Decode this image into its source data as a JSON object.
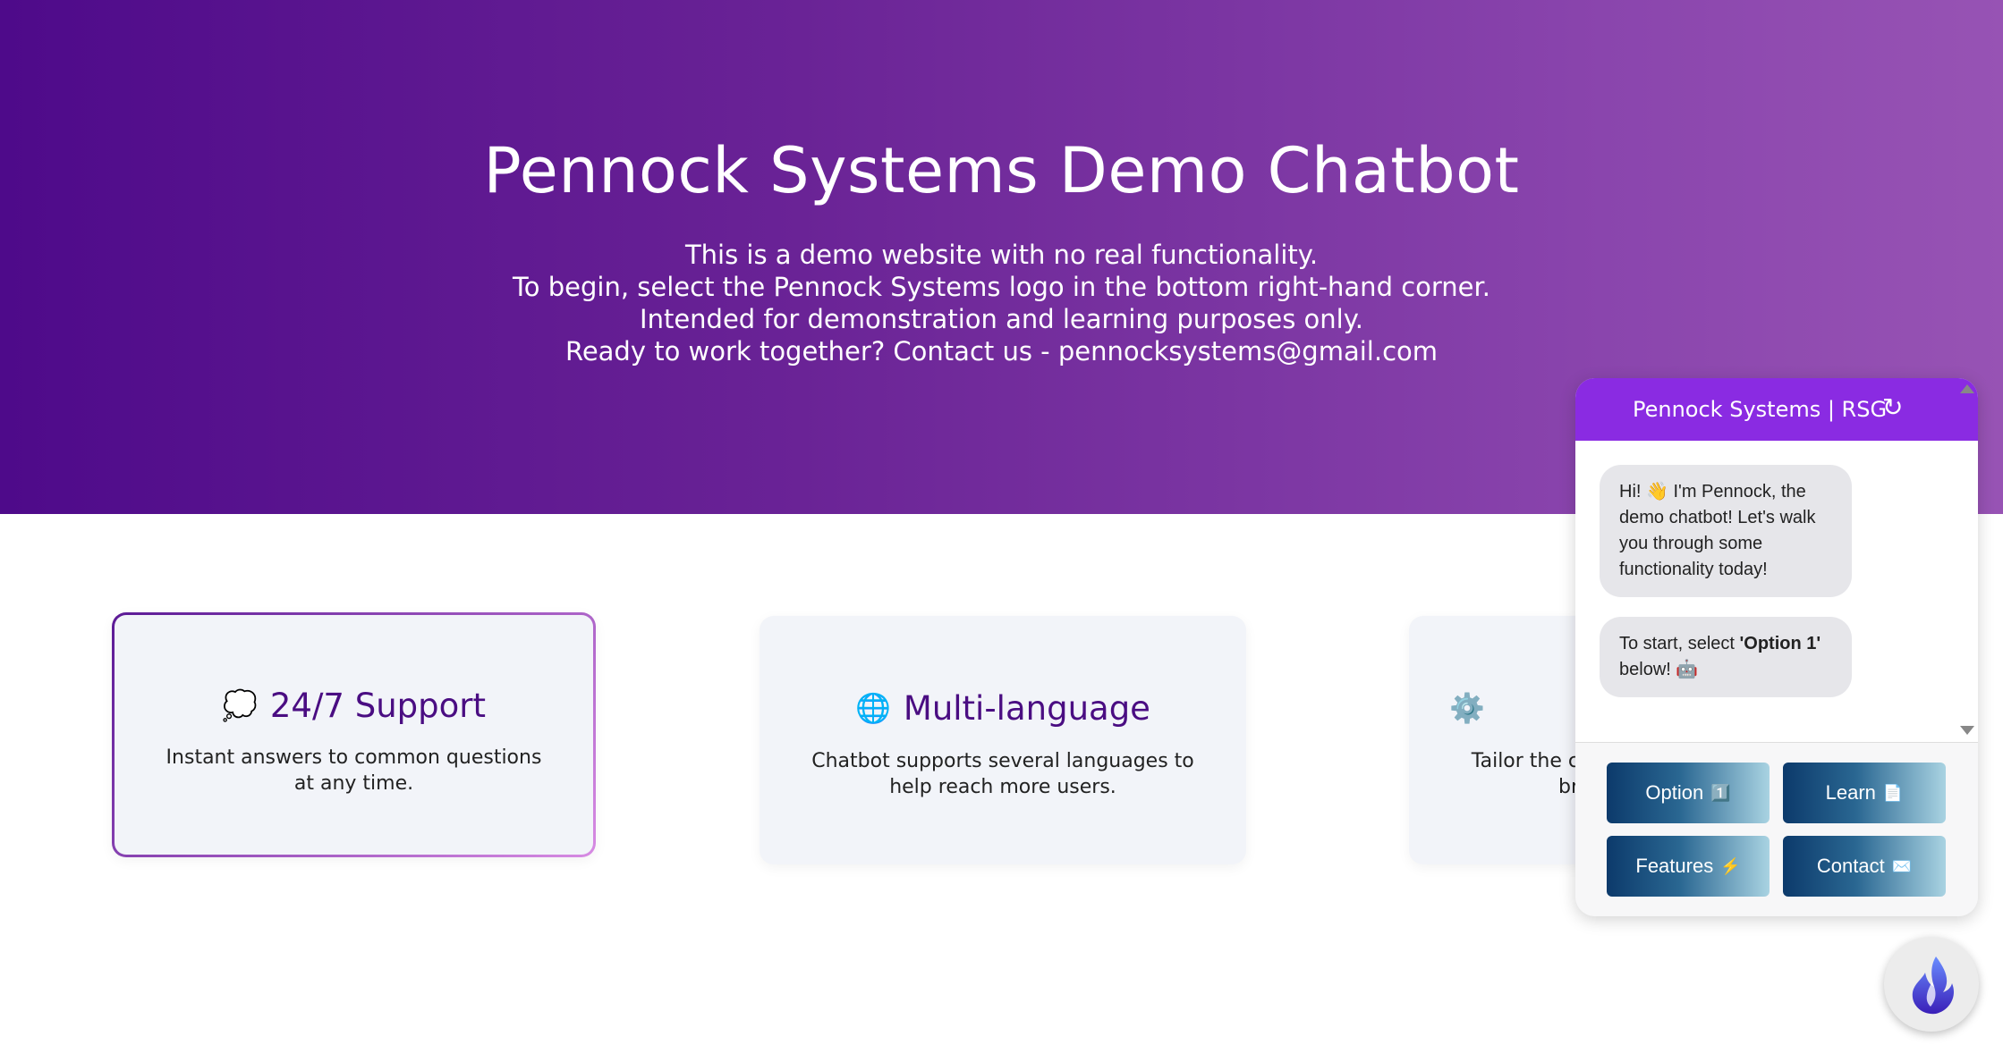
{
  "hero": {
    "title": "Pennock Systems Demo Chatbot",
    "lines": [
      "This is a demo website with no real functionality.",
      "To begin, select the Pennock Systems logo in the bottom right-hand corner.",
      "Intended for demonstration and learning purposes only.",
      "Ready to work together? Contact us - pennocksystems@gmail.com"
    ]
  },
  "features": [
    {
      "icon": "speech-bubble-icon",
      "glyph": "💭",
      "title": "24/7 Support",
      "desc": "Instant answers to common questions at any time."
    },
    {
      "icon": "globe-icon",
      "glyph": "🌐",
      "title": "Multi-language",
      "desc": "Chatbot supports several languages to help reach more users."
    },
    {
      "icon": "gear-icon",
      "glyph": "⚙️",
      "title": "",
      "desc": "Tailor the c br"
    }
  ],
  "chat": {
    "header": "Pennock Systems | RSG",
    "refresh_icon": "↻",
    "messages": [
      {
        "pre": "Hi! 👋 I'm Pennock, the demo chatbot! Let's walk you through some functionality today!"
      },
      {
        "pre": "To start, select ",
        "bold": "'Option 1'",
        "post": " below! 🤖"
      }
    ],
    "buttons": [
      {
        "label": "Option",
        "emoji": "1️⃣"
      },
      {
        "label": "Learn",
        "emoji": "📄"
      },
      {
        "label": "Features",
        "emoji": "⚡"
      },
      {
        "label": "Contact",
        "emoji": "✉️"
      }
    ]
  },
  "colors": {
    "accent": "#8a2be2",
    "hero_start": "#4e0a8a",
    "hero_end": "#9753b4",
    "title_purple": "#4a0d82"
  }
}
